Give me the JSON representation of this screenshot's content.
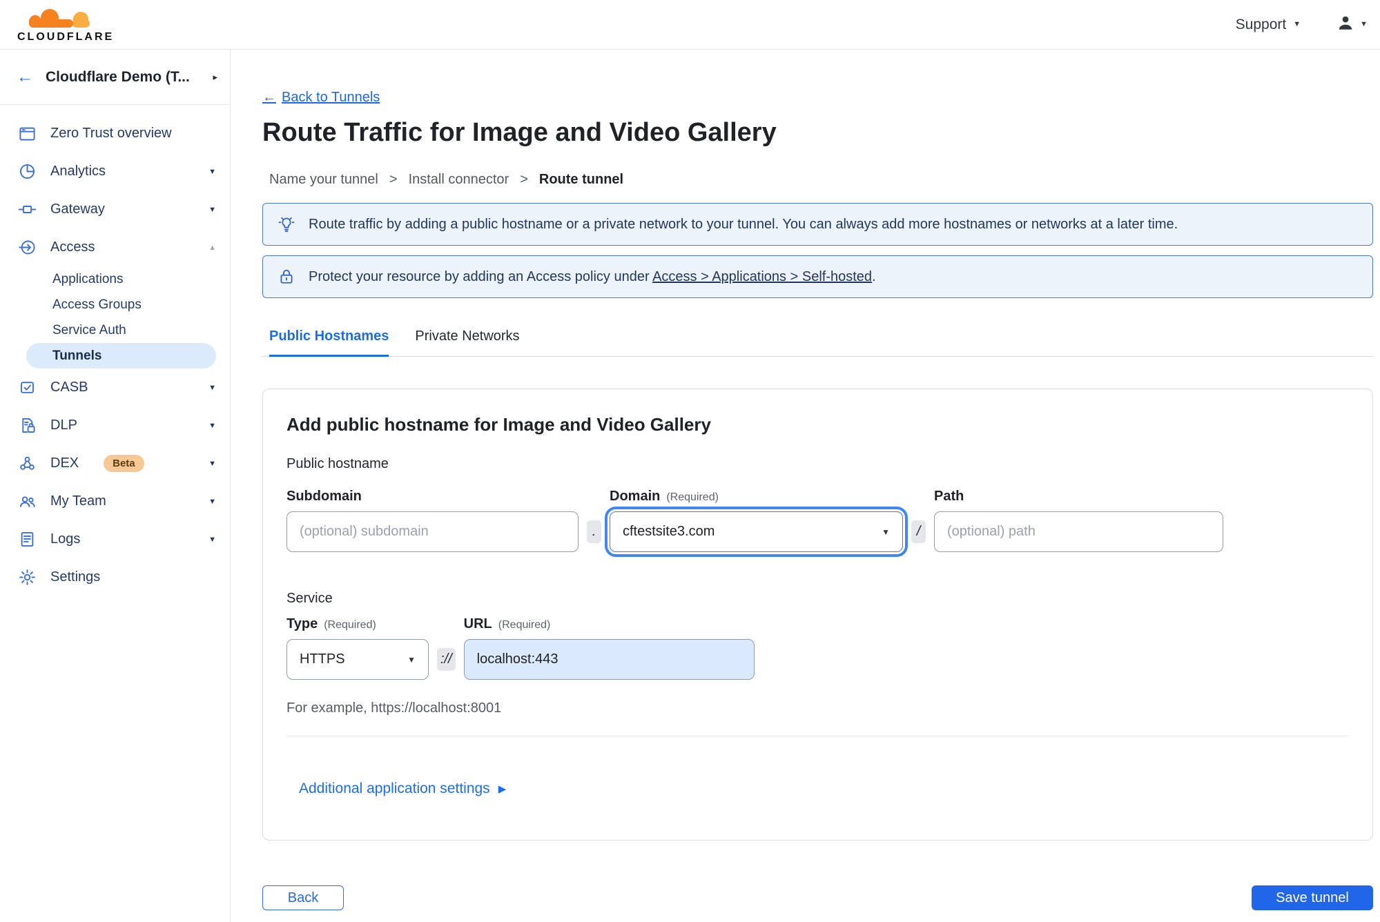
{
  "icons": {
    "arrow_left": "←",
    "caret_down": "▼",
    "caret_up": "▲",
    "chevron_right": "▸",
    "caret_right": "▶"
  },
  "colors": {
    "accent_blue": "#2166e9",
    "link_blue": "#2068e8",
    "banner_bg": "#ecf3fb",
    "banner_border": "#4d79c9",
    "active_pill_bg": "#dcebfb",
    "beta_badge_bg": "#f6c896",
    "url_field_bg": "#dbe9fc",
    "logo_orange": "#f6821f",
    "logo_light_orange": "#fbad41"
  },
  "header": {
    "logo_text": "CLOUDFLARE",
    "support_label": "Support"
  },
  "sidebar": {
    "account_name": "Cloudflare Demo (T...",
    "items": [
      {
        "label": "Zero Trust overview"
      },
      {
        "label": "Analytics"
      },
      {
        "label": "Gateway"
      },
      {
        "label": "Access"
      },
      {
        "label": "Applications"
      },
      {
        "label": "Access Groups"
      },
      {
        "label": "Service Auth"
      },
      {
        "label": "Tunnels"
      },
      {
        "label": "CASB"
      },
      {
        "label": "DLP"
      },
      {
        "label": "DEX",
        "badge": "Beta"
      },
      {
        "label": "My Team"
      },
      {
        "label": "Logs"
      },
      {
        "label": "Settings"
      }
    ]
  },
  "page": {
    "back_label": "Back to Tunnels",
    "title": "Route Traffic for Image and Video Gallery",
    "steps": [
      "Name your tunnel",
      "Install connector",
      "Route tunnel"
    ],
    "step_separator": ">"
  },
  "banners": {
    "tip_text": "Route traffic by adding a public hostname or a private network to your tunnel. You can always add more hostnames or networks at a later time.",
    "policy_prefix": "Protect your resource by adding an Access policy under",
    "policy_link": "Access > Applications > Self-hosted",
    "policy_suffix": "."
  },
  "tabs": [
    {
      "label": "Public Hostnames"
    },
    {
      "label": "Private Networks"
    }
  ],
  "form": {
    "card_title": "Add public hostname for Image and Video Gallery",
    "hostname_section": "Public hostname",
    "subdomain_label": "Subdomain",
    "subdomain_placeholder": "(optional) subdomain",
    "dot_separator": ".",
    "domain_label": "Domain",
    "required_hint": "(Required)",
    "domain_value": "cftestsite3.com",
    "slash_separator": "/",
    "path_label": "Path",
    "path_placeholder": "(optional) path",
    "service_section": "Service",
    "type_label": "Type",
    "type_value": "HTTPS",
    "scheme_separator": "://",
    "url_label": "URL",
    "url_value": "localhost:443",
    "example_text": "For example, https://localhost:8001",
    "additional_settings_label": "Additional application settings"
  },
  "actions": {
    "back_label": "Back",
    "save_label": "Save tunnel"
  }
}
